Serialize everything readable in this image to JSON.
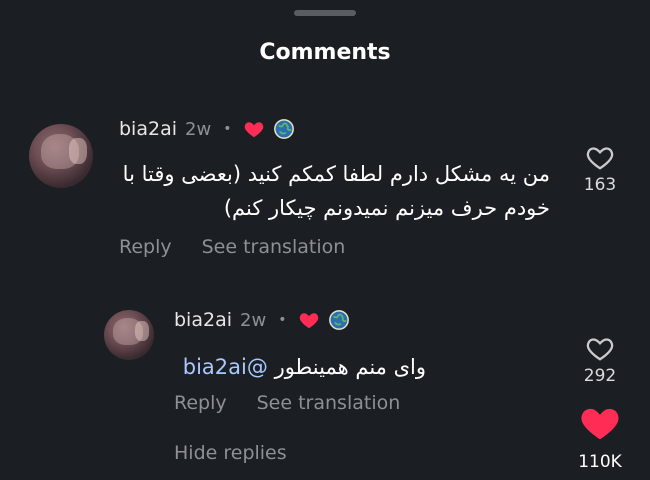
{
  "header": {
    "title": "Comments"
  },
  "colors": {
    "background": "#1b1e22",
    "secondary_text": "#8d9095",
    "heart_red": "#ff2d55",
    "mention": "#a9c8ff"
  },
  "comments": [
    {
      "username": "bia2ai",
      "time": "2w",
      "separator": "•",
      "badges": [
        "heart-icon",
        "globe-icon"
      ],
      "text": "من یه مشکل دارم لطفا کمکم کنید (بعضی وقتا با خودم حرف میزنم نمیدونم چیکار کنم)",
      "reply_label": "Reply",
      "translate_label": "See translation",
      "like_count": "163",
      "liked": false
    }
  ],
  "replies": [
    {
      "username": "bia2ai",
      "time": "2w",
      "separator": "•",
      "badges": [
        "heart-icon",
        "globe-icon"
      ],
      "text": "وای منم همینطور",
      "mention": "@bia2ai",
      "reply_label": "Reply",
      "translate_label": "See translation",
      "like_count": "292",
      "liked": false
    }
  ],
  "hide_replies_label": "Hide replies",
  "big_like": {
    "count": "110K",
    "liked": true
  }
}
